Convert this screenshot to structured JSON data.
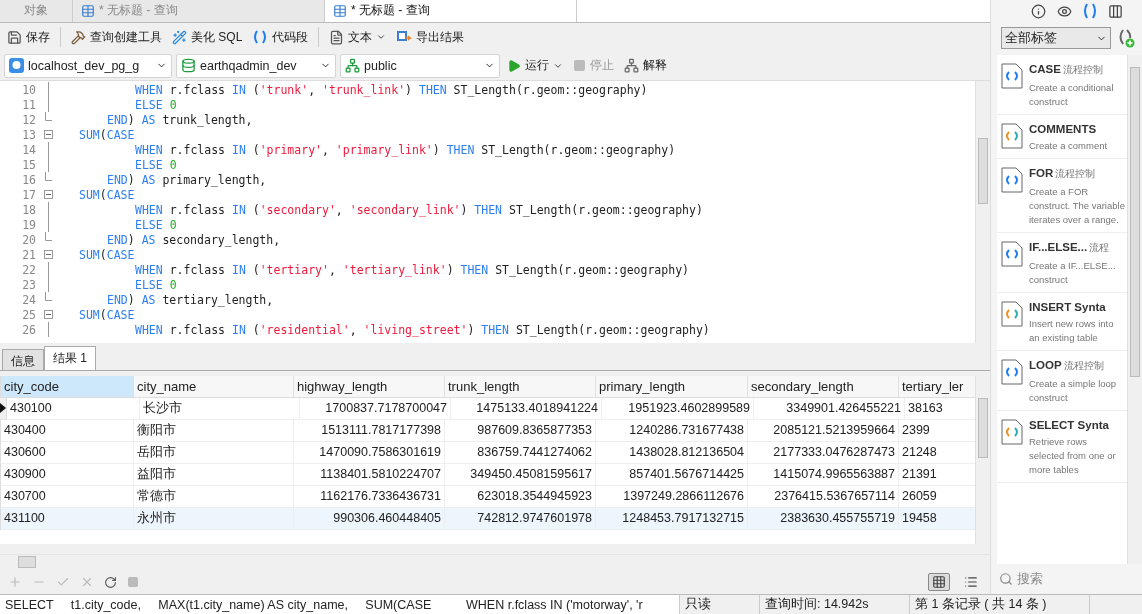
{
  "doc_tabs": [
    {
      "label": "对象",
      "kind": "objects",
      "selected": false
    },
    {
      "label": "* 无标题 - 查询",
      "kind": "query",
      "selected": false
    },
    {
      "label": "* 无标题 - 查询",
      "kind": "query",
      "selected": true
    }
  ],
  "toolbar": [
    {
      "label": "保存",
      "kind": "save",
      "dropdown": false
    },
    {
      "label": "查询创建工具",
      "kind": "builder",
      "dropdown": false
    },
    {
      "label": "美化 SQL",
      "kind": "beautify",
      "dropdown": false
    },
    {
      "label": "代码段",
      "kind": "snippet",
      "dropdown": false
    },
    {
      "label": "文本",
      "kind": "text",
      "dropdown": true
    },
    {
      "label": "导出结果",
      "kind": "export",
      "dropdown": false
    }
  ],
  "connection": {
    "server": "localhost_dev_pg_g",
    "database": "earthqadmin_dev",
    "schema": "public"
  },
  "run_buttons": [
    {
      "label": "运行",
      "kind": "run",
      "dropdown": true,
      "disabled": false
    },
    {
      "label": "停止",
      "kind": "stop",
      "dropdown": false,
      "disabled": true
    },
    {
      "label": "解释",
      "kind": "explain",
      "dropdown": false,
      "disabled": false
    }
  ],
  "editor": {
    "lines": [
      {
        "number": "10",
        "kind": "body",
        "tokens": [
          {
            "kind": "keyword",
            "text": "WHEN"
          },
          {
            "kind": "plain",
            "text": " r.fclass "
          },
          {
            "kind": "keyword",
            "text": "IN"
          },
          {
            "kind": "plain",
            "text": " ("
          },
          {
            "kind": "string",
            "text": "'trunk'"
          },
          {
            "kind": "plain",
            "text": ", "
          },
          {
            "kind": "string",
            "text": "'trunk_link'"
          },
          {
            "kind": "plain",
            "text": ") "
          },
          {
            "kind": "keyword",
            "text": "THEN"
          },
          {
            "kind": "plain",
            "text": " ST_Length(r.geom::geography)"
          }
        ]
      },
      {
        "number": "11",
        "kind": "body",
        "tokens": [
          {
            "kind": "keyword",
            "text": "ELSE"
          },
          {
            "kind": "number",
            "text": " 0"
          }
        ]
      },
      {
        "number": "12",
        "kind": "block_end",
        "tokens": [
          {
            "kind": "keyword",
            "text": "END"
          },
          {
            "kind": "plain",
            "text": ") "
          },
          {
            "kind": "keyword",
            "text": "AS"
          },
          {
            "kind": "plain",
            "text": " trunk_length,"
          }
        ]
      },
      {
        "number": "13",
        "kind": "block_start",
        "tokens": [
          {
            "kind": "keyword",
            "text": "SUM"
          },
          {
            "kind": "plain",
            "text": "("
          },
          {
            "kind": "keyword",
            "text": "CASE"
          }
        ]
      },
      {
        "number": "14",
        "kind": "body",
        "tokens": [
          {
            "kind": "keyword",
            "text": "WHEN"
          },
          {
            "kind": "plain",
            "text": " r.fclass "
          },
          {
            "kind": "keyword",
            "text": "IN"
          },
          {
            "kind": "plain",
            "text": " ("
          },
          {
            "kind": "string",
            "text": "'primary'"
          },
          {
            "kind": "plain",
            "text": ", "
          },
          {
            "kind": "string",
            "text": "'primary_link'"
          },
          {
            "kind": "plain",
            "text": ") "
          },
          {
            "kind": "keyword",
            "text": "THEN"
          },
          {
            "kind": "plain",
            "text": " ST_Length(r.geom::geography)"
          }
        ]
      },
      {
        "number": "15",
        "kind": "body",
        "tokens": [
          {
            "kind": "keyword",
            "text": "ELSE"
          },
          {
            "kind": "number",
            "text": " 0"
          }
        ]
      },
      {
        "number": "16",
        "kind": "block_end",
        "tokens": [
          {
            "kind": "keyword",
            "text": "END"
          },
          {
            "kind": "plain",
            "text": ") "
          },
          {
            "kind": "keyword",
            "text": "AS"
          },
          {
            "kind": "plain",
            "text": " primary_length,"
          }
        ]
      },
      {
        "number": "17",
        "kind": "block_start",
        "tokens": [
          {
            "kind": "keyword",
            "text": "SUM"
          },
          {
            "kind": "plain",
            "text": "("
          },
          {
            "kind": "keyword",
            "text": "CASE"
          }
        ]
      },
      {
        "number": "18",
        "kind": "body",
        "tokens": [
          {
            "kind": "keyword",
            "text": "WHEN"
          },
          {
            "kind": "plain",
            "text": " r.fclass "
          },
          {
            "kind": "keyword",
            "text": "IN"
          },
          {
            "kind": "plain",
            "text": " ("
          },
          {
            "kind": "string",
            "text": "'secondary'"
          },
          {
            "kind": "plain",
            "text": ", "
          },
          {
            "kind": "string",
            "text": "'secondary_link'"
          },
          {
            "kind": "plain",
            "text": ") "
          },
          {
            "kind": "keyword",
            "text": "THEN"
          },
          {
            "kind": "plain",
            "text": " ST_Length(r.geom::geography)"
          }
        ]
      },
      {
        "number": "19",
        "kind": "body",
        "tokens": [
          {
            "kind": "keyword",
            "text": "ELSE"
          },
          {
            "kind": "number",
            "text": " 0"
          }
        ]
      },
      {
        "number": "20",
        "kind": "block_end",
        "tokens": [
          {
            "kind": "keyword",
            "text": "END"
          },
          {
            "kind": "plain",
            "text": ") "
          },
          {
            "kind": "keyword",
            "text": "AS"
          },
          {
            "kind": "plain",
            "text": " secondary_length,"
          }
        ]
      },
      {
        "number": "21",
        "kind": "block_start",
        "tokens": [
          {
            "kind": "keyword",
            "text": "SUM"
          },
          {
            "kind": "plain",
            "text": "("
          },
          {
            "kind": "keyword",
            "text": "CASE"
          }
        ]
      },
      {
        "number": "22",
        "kind": "body",
        "tokens": [
          {
            "kind": "keyword",
            "text": "WHEN"
          },
          {
            "kind": "plain",
            "text": " r.fclass "
          },
          {
            "kind": "keyword",
            "text": "IN"
          },
          {
            "kind": "plain",
            "text": " ("
          },
          {
            "kind": "string",
            "text": "'tertiary'"
          },
          {
            "kind": "plain",
            "text": ", "
          },
          {
            "kind": "string",
            "text": "'tertiary_link'"
          },
          {
            "kind": "plain",
            "text": ") "
          },
          {
            "kind": "keyword",
            "text": "THEN"
          },
          {
            "kind": "plain",
            "text": " ST_Length(r.geom::geography)"
          }
        ]
      },
      {
        "number": "23",
        "kind": "body",
        "tokens": [
          {
            "kind": "keyword",
            "text": "ELSE"
          },
          {
            "kind": "number",
            "text": " 0"
          }
        ]
      },
      {
        "number": "24",
        "kind": "block_end",
        "tokens": [
          {
            "kind": "keyword",
            "text": "END"
          },
          {
            "kind": "plain",
            "text": ") "
          },
          {
            "kind": "keyword",
            "text": "AS"
          },
          {
            "kind": "plain",
            "text": " tertiary_length,"
          }
        ]
      },
      {
        "number": "25",
        "kind": "block_start",
        "tokens": [
          {
            "kind": "keyword",
            "text": "SUM"
          },
          {
            "kind": "plain",
            "text": "("
          },
          {
            "kind": "keyword",
            "text": "CASE"
          }
        ]
      },
      {
        "number": "26",
        "kind": "body",
        "tokens": [
          {
            "kind": "keyword",
            "text": "WHEN"
          },
          {
            "kind": "plain",
            "text": " r.fclass "
          },
          {
            "kind": "keyword",
            "text": "IN"
          },
          {
            "kind": "plain",
            "text": " ("
          },
          {
            "kind": "string",
            "text": "'residential'"
          },
          {
            "kind": "plain",
            "text": ", "
          },
          {
            "kind": "string",
            "text": "'living_street'"
          },
          {
            "kind": "plain",
            "text": ") "
          },
          {
            "kind": "keyword",
            "text": "THEN"
          },
          {
            "kind": "plain",
            "text": " ST_Length(r.geom::geography)"
          }
        ]
      }
    ]
  },
  "result_tabs": [
    {
      "label": "信息",
      "selected": false
    },
    {
      "label": "结果 1",
      "selected": true
    }
  ],
  "table": {
    "columns": [
      {
        "label": "city_code",
        "kind": "text",
        "selected": true
      },
      {
        "label": "city_name",
        "kind": "text",
        "selected": false
      },
      {
        "label": "highway_length",
        "kind": "number",
        "selected": false
      },
      {
        "label": "trunk_length",
        "kind": "number",
        "selected": false
      },
      {
        "label": "primary_length",
        "kind": "number",
        "selected": false
      },
      {
        "label": "secondary_length",
        "kind": "number",
        "selected": false
      },
      {
        "label": "tertiary_ler",
        "kind": "text",
        "selected": false
      }
    ],
    "rows": [
      {
        "selected": true,
        "highlighted": false,
        "cells": [
          "430100",
          "长沙市",
          "1700837.7178700047",
          "1475133.4018941224",
          "1951923.4602899589",
          "3349901.426455221",
          "38163"
        ]
      },
      {
        "selected": false,
        "highlighted": false,
        "cells": [
          "430400",
          "衡阳市",
          "1513111.7817177398",
          "987609.8365877353",
          "1240286.731677438",
          "2085121.5213959664",
          "2399"
        ]
      },
      {
        "selected": false,
        "highlighted": false,
        "cells": [
          "430600",
          "岳阳市",
          "1470090.7586301619",
          "836759.7441274062",
          "1438028.812136504",
          "2177333.0476287473",
          "21248"
        ]
      },
      {
        "selected": false,
        "highlighted": false,
        "cells": [
          "430900",
          "益阳市",
          "1138401.5810224707",
          "349450.45081595617",
          "857401.5676714425",
          "1415074.9965563887",
          "21391"
        ]
      },
      {
        "selected": false,
        "highlighted": false,
        "cells": [
          "430700",
          "常德市",
          "1162176.7336436731",
          "623018.3544945923",
          "1397249.2866112676",
          "2376415.5367657114",
          "26059"
        ]
      },
      {
        "selected": false,
        "highlighted": true,
        "cells": [
          "431100",
          "永州市",
          "990306.460448405",
          "742812.9747601978",
          "1248453.7917132715",
          "2383630.455755719",
          "19458"
        ]
      }
    ]
  },
  "view_buttons": [
    {
      "kind": "grid",
      "selected": true
    },
    {
      "kind": "form",
      "selected": false
    }
  ],
  "status_bar": {
    "sql": "SELECT     t1.city_code,     MAX(t1.city_name) AS city_name,     SUM(CASE          WHEN r.fclass IN ('motorway', 'r",
    "mode": "只读",
    "time": "查询时间: 14.942s",
    "records": "第 1 条记录 ( 共 14 条 )"
  },
  "side_panel": {
    "tabs": [
      {
        "kind": "info",
        "selected": false
      },
      {
        "kind": "preview",
        "selected": false
      },
      {
        "kind": "snippets",
        "selected": true
      },
      {
        "kind": "columns",
        "selected": false
      }
    ],
    "filter": "全部标签",
    "snippets": [
      {
        "title": "CASE",
        "tag": "流程控制",
        "description": "Create a conditional construct",
        "kind": "flow"
      },
      {
        "title": "COMMENTS",
        "description": "Create a comment",
        "kind": "syntax"
      },
      {
        "title": "FOR",
        "tag": "流程控制",
        "description": "Create a FOR construct. The variable iterates over a range.",
        "kind": "flow"
      },
      {
        "title": "IF...ELSE...",
        "tag": "流程",
        "description": "Create a IF...ELSE... construct",
        "kind": "flow"
      },
      {
        "title": "INSERT Synta",
        "description": "Insert new rows into an existing table",
        "kind": "syntax"
      },
      {
        "title": "LOOP",
        "tag": "流程控制",
        "description": "Create a simple loop construct",
        "kind": "flow"
      },
      {
        "title": "SELECT Synta",
        "description": "Retrieve rows selected from one or more tables",
        "kind": "syntax"
      }
    ],
    "search": {
      "placeholder": "搜索"
    }
  }
}
